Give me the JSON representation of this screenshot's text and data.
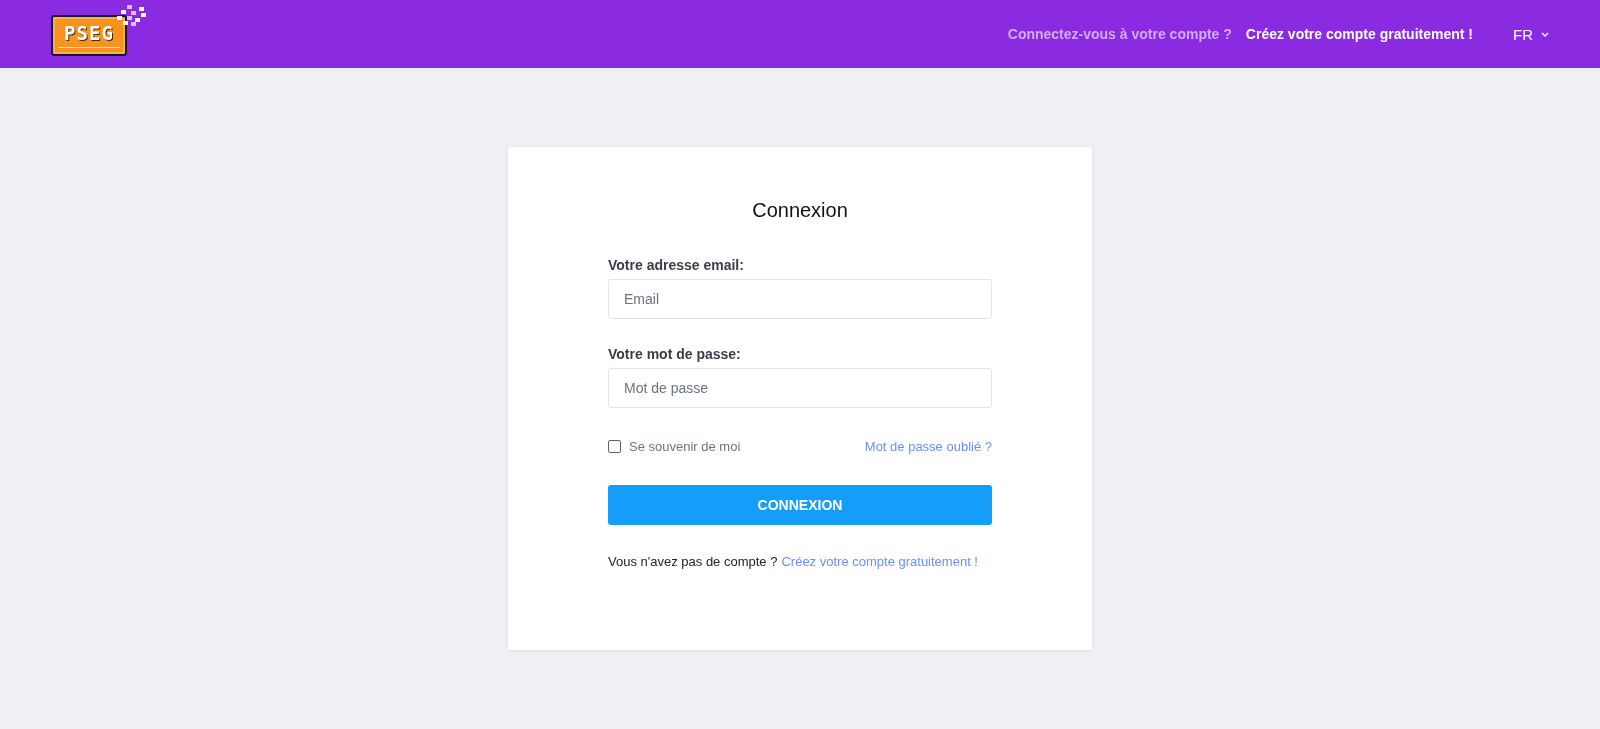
{
  "header": {
    "logo": {
      "text": "PSEG"
    },
    "nav": [
      {
        "label": "Connectez-vous à votre compte ?",
        "dimmed": true
      },
      {
        "label": "Créez votre compte gratuitement !",
        "dimmed": false
      }
    ],
    "language": {
      "label": "FR"
    }
  },
  "card": {
    "title": "Connexion",
    "fields": [
      {
        "label": "Votre adresse email:",
        "placeholder": "Email"
      },
      {
        "label": "Votre mot de passe:",
        "placeholder": "Mot de passe"
      }
    ],
    "remember": {
      "label": "Se souvenir de moi",
      "checked": false
    },
    "forgot_link": "Mot de passe oublié ?",
    "submit": "CONNEXION",
    "signup": {
      "text": "Vous n'avez pas de compte ?",
      "link": "Créez votre compte gratuitement !"
    }
  }
}
